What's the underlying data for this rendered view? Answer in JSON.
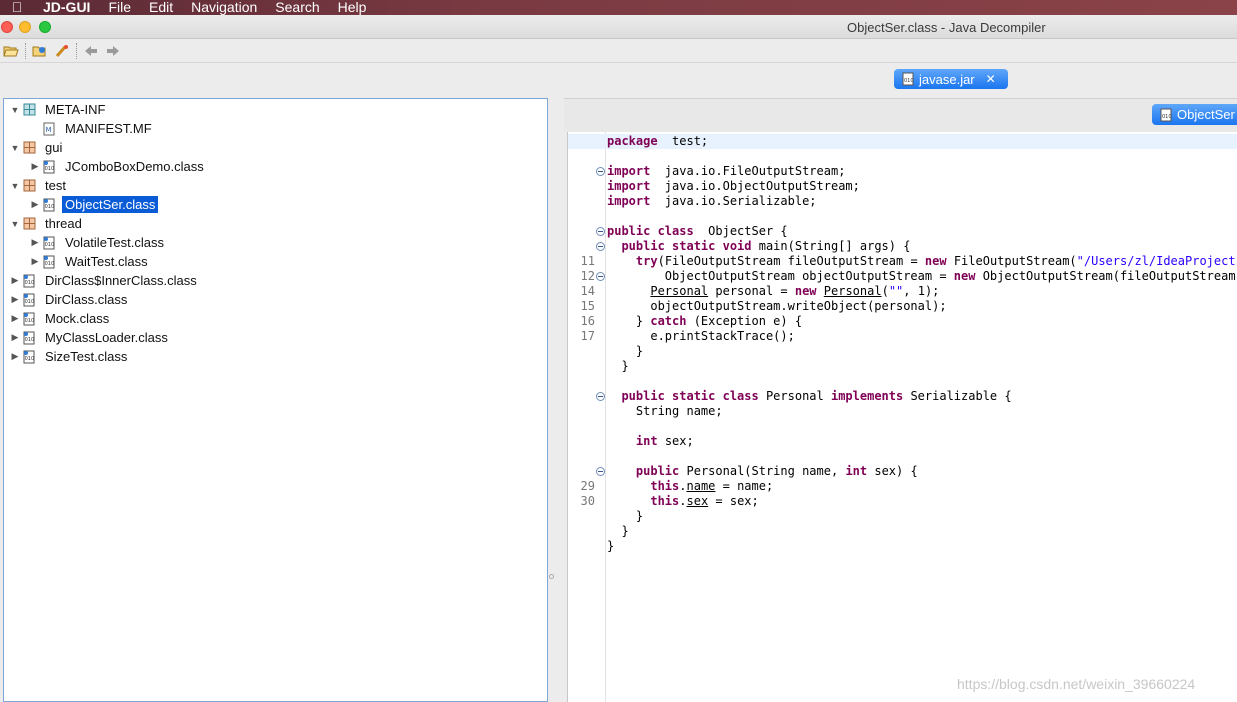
{
  "menubar": {
    "app": "JD-GUI",
    "items": [
      "File",
      "Edit",
      "Navigation",
      "Search",
      "Help"
    ]
  },
  "window": {
    "title": "ObjectSer.class - Java Decompiler"
  },
  "toolbar": {
    "icons": [
      "open-file-icon",
      "open-type-icon",
      "search-icon",
      "back-icon",
      "forward-icon"
    ]
  },
  "tabs": {
    "jar_tab": "javase.jar",
    "class_tab": "ObjectSer"
  },
  "tree": {
    "nodes": [
      {
        "label": "META-INF",
        "arrow": "▼",
        "icon": "package"
      },
      {
        "label": "MANIFEST.MF",
        "arrow": "",
        "icon": "manifest"
      },
      {
        "label": "gui",
        "arrow": "▼",
        "icon": "package"
      },
      {
        "label": "JComboBoxDemo.class",
        "arrow": "▶",
        "icon": "class"
      },
      {
        "label": "test",
        "arrow": "▼",
        "icon": "package"
      },
      {
        "label": "ObjectSer.class",
        "arrow": "▶",
        "icon": "class"
      },
      {
        "label": "thread",
        "arrow": "▼",
        "icon": "package"
      },
      {
        "label": "VolatileTest.class",
        "arrow": "▶",
        "icon": "class"
      },
      {
        "label": "WaitTest.class",
        "arrow": "▶",
        "icon": "class"
      },
      {
        "label": "DirClass$InnerClass.class",
        "arrow": "▶",
        "icon": "class"
      },
      {
        "label": "DirClass.class",
        "arrow": "▶",
        "icon": "class"
      },
      {
        "label": "Mock.class",
        "arrow": "▶",
        "icon": "class"
      },
      {
        "label": "MyClassLoader.class",
        "arrow": "▶",
        "icon": "class"
      },
      {
        "label": "SizeTest.class",
        "arrow": "▶",
        "icon": "class"
      }
    ]
  },
  "editor": {
    "lines": [
      {
        "n": "",
        "segs": [
          [
            "kw",
            "package"
          ],
          [
            "",
            "  test;"
          ]
        ]
      },
      {
        "n": "",
        "segs": []
      },
      {
        "n": "",
        "segs": [
          [
            "kw",
            "import"
          ],
          [
            "",
            "  java.io.FileOutputStream;"
          ]
        ]
      },
      {
        "n": "",
        "segs": [
          [
            "kw",
            "import"
          ],
          [
            "",
            "  java.io.ObjectOutputStream;"
          ]
        ]
      },
      {
        "n": "",
        "segs": [
          [
            "kw",
            "import"
          ],
          [
            "",
            "  java.io.Serializable;"
          ]
        ]
      },
      {
        "n": "",
        "segs": []
      },
      {
        "n": "",
        "segs": [
          [
            "kw",
            "public class"
          ],
          [
            "",
            "  ObjectSer {"
          ]
        ]
      },
      {
        "n": "",
        "segs": [
          [
            "",
            "  "
          ],
          [
            "kw",
            "public static void"
          ],
          [
            "",
            " main(String[] args) {"
          ]
        ]
      },
      {
        "n": "11",
        "segs": [
          [
            "",
            "    "
          ],
          [
            "kw",
            "try"
          ],
          [
            "",
            "(FileOutputStream fileOutputStream = "
          ],
          [
            "kw",
            "new"
          ],
          [
            "",
            " FileOutputStream("
          ],
          [
            "str",
            "\"/Users/zl/IdeaProjects/j"
          ]
        ]
      },
      {
        "n": "12",
        "segs": [
          [
            "",
            "        ObjectOutputStream objectOutputStream = "
          ],
          [
            "kw",
            "new"
          ],
          [
            "",
            " ObjectOutputStream(fileOutputStream))"
          ]
        ]
      },
      {
        "n": "14",
        "segs": [
          [
            "",
            "      "
          ],
          [
            "ul",
            "Personal"
          ],
          [
            "",
            " personal = "
          ],
          [
            "kw",
            "new"
          ],
          [
            "",
            " "
          ],
          [
            "ul",
            "Personal"
          ],
          [
            "",
            "("
          ],
          [
            "str",
            "\"\""
          ],
          [
            "",
            ", 1);"
          ]
        ]
      },
      {
        "n": "15",
        "segs": [
          [
            "",
            "      objectOutputStream.writeObject(personal);"
          ]
        ]
      },
      {
        "n": "16",
        "segs": [
          [
            "",
            "    } "
          ],
          [
            "kw",
            "catch"
          ],
          [
            "",
            " (Exception e) {"
          ]
        ]
      },
      {
        "n": "17",
        "segs": [
          [
            "",
            "      e.printStackTrace();"
          ]
        ]
      },
      {
        "n": "",
        "segs": [
          [
            "",
            "    }"
          ]
        ]
      },
      {
        "n": "",
        "segs": [
          [
            "",
            "  }"
          ]
        ]
      },
      {
        "n": "",
        "segs": []
      },
      {
        "n": "",
        "segs": [
          [
            "",
            "  "
          ],
          [
            "kw",
            "public static class"
          ],
          [
            "",
            " Personal "
          ],
          [
            "kw",
            "implements"
          ],
          [
            "",
            " Serializable {"
          ]
        ]
      },
      {
        "n": "",
        "segs": [
          [
            "",
            "    String name;"
          ]
        ]
      },
      {
        "n": "",
        "segs": []
      },
      {
        "n": "",
        "segs": [
          [
            "",
            "    "
          ],
          [
            "kw",
            "int"
          ],
          [
            "",
            " sex;"
          ]
        ]
      },
      {
        "n": "",
        "segs": []
      },
      {
        "n": "",
        "segs": [
          [
            "",
            "    "
          ],
          [
            "kw",
            "public"
          ],
          [
            "",
            " Personal(String name, "
          ],
          [
            "kw",
            "int"
          ],
          [
            "",
            " sex) {"
          ]
        ]
      },
      {
        "n": "29",
        "segs": [
          [
            "",
            "      "
          ],
          [
            "kw",
            "this"
          ],
          [
            "",
            "."
          ],
          [
            "ul",
            "name"
          ],
          [
            "",
            " = name;"
          ]
        ]
      },
      {
        "n": "30",
        "segs": [
          [
            "",
            "      "
          ],
          [
            "kw",
            "this"
          ],
          [
            "",
            "."
          ],
          [
            "ul",
            "sex"
          ],
          [
            "",
            " = sex;"
          ]
        ]
      },
      {
        "n": "",
        "segs": [
          [
            "",
            "    }"
          ]
        ]
      },
      {
        "n": "",
        "segs": [
          [
            "",
            "  }"
          ]
        ]
      },
      {
        "n": "",
        "segs": [
          [
            "",
            "}"
          ]
        ]
      }
    ]
  },
  "watermark": "https://blog.csdn.net/weixin_39660224"
}
